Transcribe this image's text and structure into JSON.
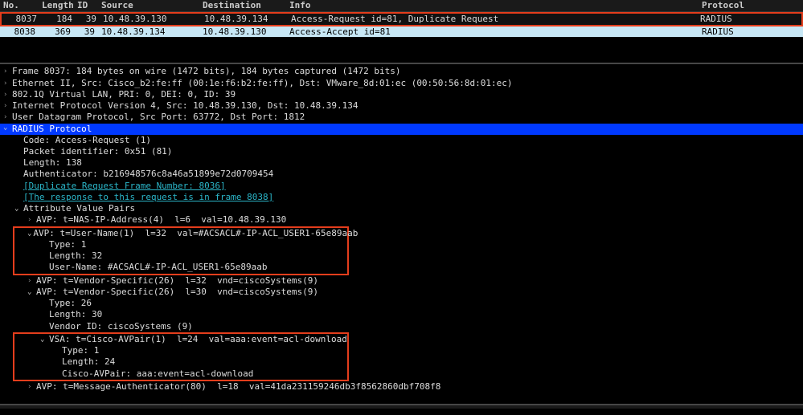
{
  "columns": {
    "no": "No.",
    "len": "Length",
    "id": "ID",
    "src": "Source",
    "dst": "Destination",
    "info": "Info",
    "proto": "Protocol"
  },
  "packets": [
    {
      "no": "8037",
      "len": "184",
      "id": "39",
      "src": "10.48.39.130",
      "dst": "10.48.39.134",
      "info": "Access-Request id=81, Duplicate Request",
      "proto": "RADIUS"
    },
    {
      "no": "8038",
      "len": "369",
      "id": "39",
      "src": "10.48.39.134",
      "dst": "10.48.39.130",
      "info": "Access-Accept id=81",
      "proto": "RADIUS"
    }
  ],
  "tree": {
    "frame": "Frame 8037: 184 bytes on wire (1472 bits), 184 bytes captured (1472 bits)",
    "eth": "Ethernet II, Src: Cisco_b2:fe:ff (00:1e:f6:b2:fe:ff), Dst: VMware_8d:01:ec (00:50:56:8d:01:ec)",
    "vlan": "802.1Q Virtual LAN, PRI: 0, DEI: 0, ID: 39",
    "ip": "Internet Protocol Version 4, Src: 10.48.39.130, Dst: 10.48.39.134",
    "udp": "User Datagram Protocol, Src Port: 63772, Dst Port: 1812",
    "radius_hdr": "RADIUS Protocol",
    "code": "Code: Access-Request (1)",
    "pktid": "Packet identifier: 0x51 (81)",
    "length": "Length: 138",
    "auth": "Authenticator: b216948576c8a46a51899e72d0709454",
    "dupframe": "[Duplicate Request Frame Number: 8036]",
    "resp_in": "[The response to this request is in frame 8038]",
    "avps_hdr": "Attribute Value Pairs",
    "avp_nas": "AVP: t=NAS-IP-Address(4)  l=6  val=10.48.39.130",
    "box1": {
      "avp": "AVP: t=User-Name(1)  l=32  val=#ACSACL#-IP-ACL_USER1-65e89aab",
      "type": "Type: 1",
      "len": "Length: 32",
      "uname": "User-Name: #ACSACL#-IP-ACL_USER1-65e89aab"
    },
    "avp_vs1": "AVP: t=Vendor-Specific(26)  l=32  vnd=ciscoSystems(9)",
    "avp_vs2": "AVP: t=Vendor-Specific(26)  l=30  vnd=ciscoSystems(9)",
    "vs2": {
      "type": "Type: 26",
      "len": "Length: 30",
      "vendor": "Vendor ID: ciscoSystems (9)"
    },
    "box2": {
      "vsa": "VSA: t=Cisco-AVPair(1)  l=24  val=aaa:event=acl-download",
      "type": "Type: 1",
      "len": "Length: 24",
      "pair": "Cisco-AVPair: aaa:event=acl-download"
    },
    "avp_msgauth": "AVP: t=Message-Authenticator(80)  l=18  val=41da231159246db3f8562860dbf708f8"
  }
}
